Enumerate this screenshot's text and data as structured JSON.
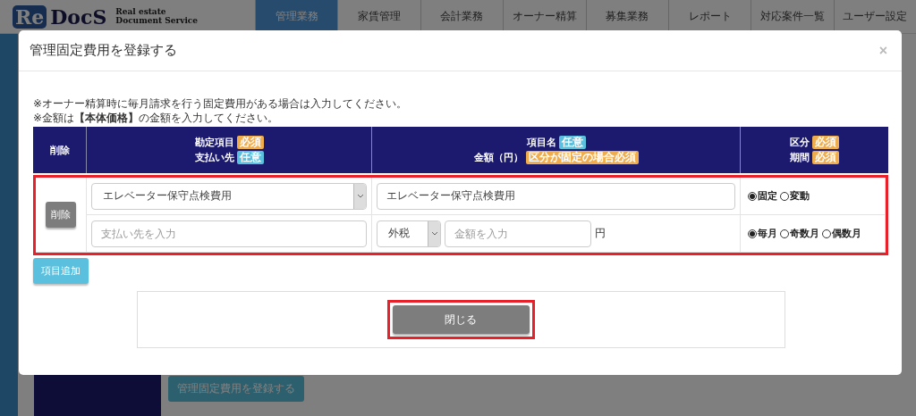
{
  "nav": {
    "logo": {
      "mark_re": "Re",
      "mark_docs": "DocS",
      "tagline_1": "Real estate",
      "tagline_2": "Document Service"
    },
    "tabs": [
      {
        "label": "管理業務",
        "selected": true
      },
      {
        "label": "家賃管理",
        "selected": false
      },
      {
        "label": "会計業務",
        "selected": false
      },
      {
        "label": "オーナー精算",
        "selected": false
      },
      {
        "label": "募集業務",
        "selected": false
      },
      {
        "label": "レポート",
        "selected": false
      },
      {
        "label": "対応案件一覧",
        "selected": false
      },
      {
        "label": "ユーザー設定",
        "selected": false
      }
    ]
  },
  "background": {
    "register_button": "管理固定費用を登録する"
  },
  "modal": {
    "title": "管理固定費用を登録する",
    "close": "×",
    "notes": [
      "※オーナー精算時に毎月請求を行う固定費用がある場合は入力してください。",
      "※金額は**【本体価格】**の金額を入力してください。"
    ],
    "columns": [
      {
        "lines": [
          {
            "label": "削除"
          }
        ]
      },
      {
        "lines": [
          {
            "label": "勘定項目",
            "badge": {
              "text": "必須",
              "kind": "required"
            }
          },
          {
            "label": "支払い先",
            "badge": {
              "text": "任意",
              "kind": "optional"
            }
          }
        ]
      },
      {
        "lines": [
          {
            "label": "項目名",
            "badge": {
              "text": "任意",
              "kind": "optional"
            }
          },
          {
            "label": "金額（円）",
            "badge": {
              "text": "区分が固定の場合必須",
              "kind": "required"
            }
          }
        ]
      },
      {
        "lines": [
          {
            "label": "区分",
            "badge": {
              "text": "必須",
              "kind": "required"
            }
          },
          {
            "label": "期間",
            "badge": {
              "text": "必須",
              "kind": "required"
            }
          }
        ]
      }
    ],
    "rows": [
      {
        "delete_button": "削除",
        "account": "エレベーター保守点検費用",
        "payee": {
          "placeholder": "支払い先を入力"
        },
        "item_name": "エレベーター保守点検費用",
        "tax": "外税",
        "amount": {
          "placeholder": "金額を入力"
        },
        "unit": "円",
        "category": [
          {
            "label": "固定",
            "selected": true
          },
          {
            "label": "変動",
            "selected": false
          }
        ],
        "period": [
          {
            "label": "毎月",
            "selected": true
          },
          {
            "label": "奇数月",
            "selected": false
          },
          {
            "label": "偶数月",
            "selected": false
          }
        ]
      }
    ],
    "add_button": "項目追加",
    "close_button": "閉じる"
  }
}
